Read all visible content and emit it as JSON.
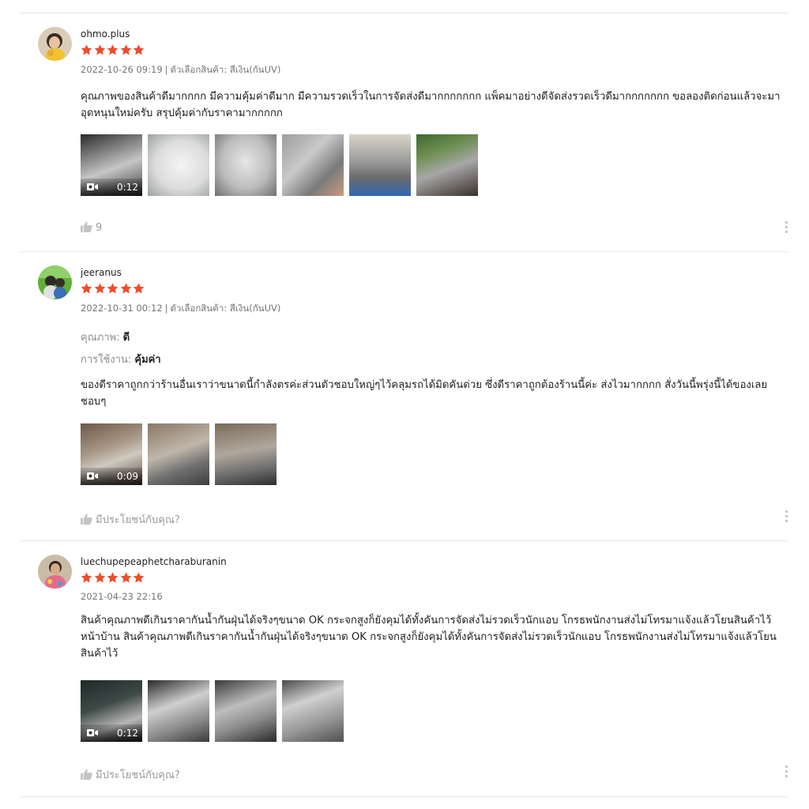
{
  "colors": {
    "star": "#ee4d2d",
    "divider": "#e8e8e8",
    "muted": "#757575"
  },
  "reviews": [
    {
      "username": "ohmo.plus",
      "rating": 5,
      "date": "2022-10-26 09:19",
      "separator": "|",
      "variant": "ตัวเลือกสินค้า: สีเงิน(กันUV)",
      "text": "คุณภาพของสินค้าดีมากกกก มีความคุ้มค่าดีมาก มีความรวดเร็วในการจัดส่งดีมากกกกกกก แพ็คมาอย่างดีจัดส่งรวดเร็วดีมากกกกกกก ขอลองติดก่อนแล้วจะมาอุดหนุนใหม่ครับ สรุปคุ้มค่ากับราคามากกกกก",
      "video_duration": "0:12",
      "like_text": "9"
    },
    {
      "username": "jeeranus",
      "rating": 5,
      "date": "2022-10-31 00:12",
      "separator": "|",
      "variant": "ตัวเลือกสินค้า: สีเงิน(กันUV)",
      "attributes": [
        {
          "key": "คุณภาพ:",
          "value": "ดี"
        },
        {
          "key": "การใช้งาน:",
          "value": "คุ้มค่า"
        }
      ],
      "text": "ของดีราคาถูกกว่าร้านอื่นเราว่าขนาดนี้กำลังตรค่ะส่วนตัวชอบใหญ่ๆไว้คลุมรถได้มิดคันด่วย ซึ่งดีราคาถูกต้องร้านนี้ค่ะ ส่งไวมากกกก สั่งวันนี้พรุ่งนี้ได้ของเลยชอบๆ",
      "video_duration": "0:09",
      "like_text": "มีประโยชน์กับคุณ?"
    },
    {
      "username": "luechupepeaphetcharaburanin",
      "rating": 5,
      "date": "2021-04-23 22:16",
      "text": "สินค้าคุณภาพดีเกินราคากันน้ำกันฝุ่นได้จริงๆขนาด OK กระจกสูงก็ยังคุมได้ทั้งคันการจัดส่งไม่รวดเร็วนักแอบ โกรธพนักงานส่งไม่โทรมาแจ้งแล้วโยนสินค้าไว้หน้าบ้าน สินค้าคุณภาพดีเกินราคากันน้ำกันฝุ่นได้จริงๆขนาด OK กระจกสูงก็ยังคุมได้ทั้งคันการจัดส่งไม่รวดเร็วนักแอบ โกรธพนักงานส่งไม่โทรมาแจ้งแล้วโยนสินค้าไว้",
      "video_duration": "0:12",
      "like_text": "มีประโยชน์กับคุณ?"
    }
  ]
}
